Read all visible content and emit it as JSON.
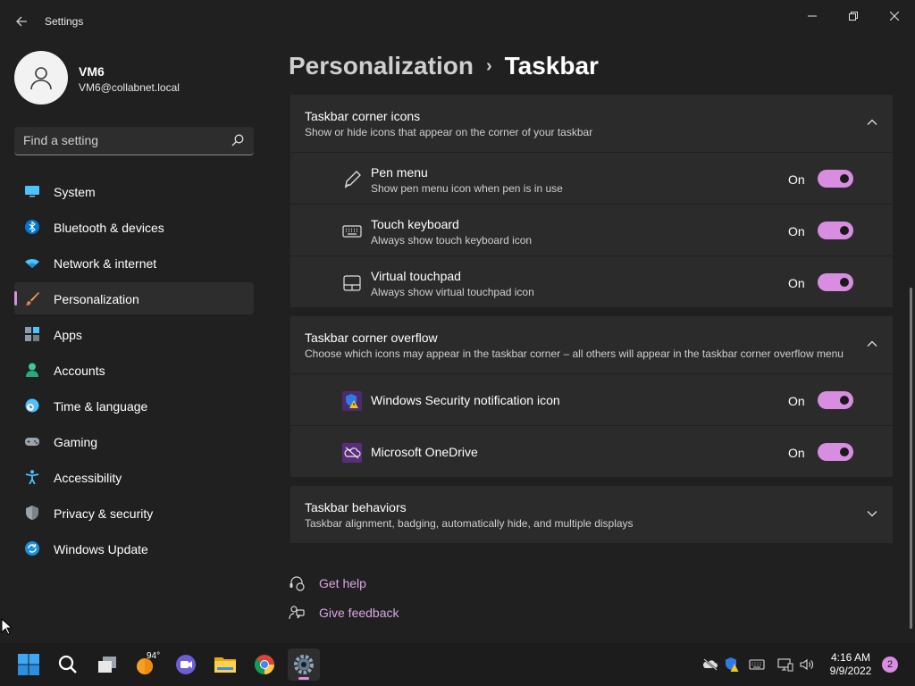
{
  "window": {
    "title": "Settings"
  },
  "user": {
    "name": "VM6",
    "email": "VM6@collabnet.local"
  },
  "search": {
    "placeholder": "Find a setting"
  },
  "nav": [
    {
      "label": "System",
      "icon": "monitor-icon",
      "active": false
    },
    {
      "label": "Bluetooth & devices",
      "icon": "bluetooth-icon",
      "active": false
    },
    {
      "label": "Network & internet",
      "icon": "wifi-icon",
      "active": false
    },
    {
      "label": "Personalization",
      "icon": "brush-icon",
      "active": true
    },
    {
      "label": "Apps",
      "icon": "apps-icon",
      "active": false
    },
    {
      "label": "Accounts",
      "icon": "person-icon",
      "active": false
    },
    {
      "label": "Time & language",
      "icon": "clock-globe-icon",
      "active": false
    },
    {
      "label": "Gaming",
      "icon": "gamepad-icon",
      "active": false
    },
    {
      "label": "Accessibility",
      "icon": "accessibility-icon",
      "active": false
    },
    {
      "label": "Privacy & security",
      "icon": "shield-icon",
      "active": false
    },
    {
      "label": "Windows Update",
      "icon": "update-icon",
      "active": false
    }
  ],
  "breadcrumb": {
    "parent": "Personalization",
    "separator": "›",
    "current": "Taskbar"
  },
  "sections": {
    "corner_icons": {
      "title": "Taskbar corner icons",
      "description": "Show or hide icons that appear on the corner of your taskbar",
      "expanded": true,
      "items": [
        {
          "title": "Pen menu",
          "description": "Show pen menu icon when pen is in use",
          "state": "On",
          "icon": "pen-icon"
        },
        {
          "title": "Touch keyboard",
          "description": "Always show touch keyboard icon",
          "state": "On",
          "icon": "keyboard-icon"
        },
        {
          "title": "Virtual touchpad",
          "description": "Always show virtual touchpad icon",
          "state": "On",
          "icon": "touchpad-icon"
        }
      ]
    },
    "corner_overflow": {
      "title": "Taskbar corner overflow",
      "description": "Choose which icons may appear in the taskbar corner – all others will appear in the taskbar corner overflow menu",
      "expanded": true,
      "items": [
        {
          "title": "Windows Security notification icon",
          "state": "On",
          "icon": "windows-security-icon"
        },
        {
          "title": "Microsoft OneDrive",
          "state": "On",
          "icon": "onedrive-icon"
        }
      ]
    },
    "behaviors": {
      "title": "Taskbar behaviors",
      "description": "Taskbar alignment, badging, automatically hide, and multiple displays",
      "expanded": false
    }
  },
  "links": {
    "help": "Get help",
    "feedback": "Give feedback"
  },
  "taskbar": {
    "weather_temp": "94°",
    "time": "4:16 AM",
    "date": "9/9/2022",
    "notification_count": "2"
  },
  "colors": {
    "accent": "#d88de0",
    "background": "#202020",
    "card": "#2b2b2b",
    "taskbar": "#1c1c1c"
  }
}
